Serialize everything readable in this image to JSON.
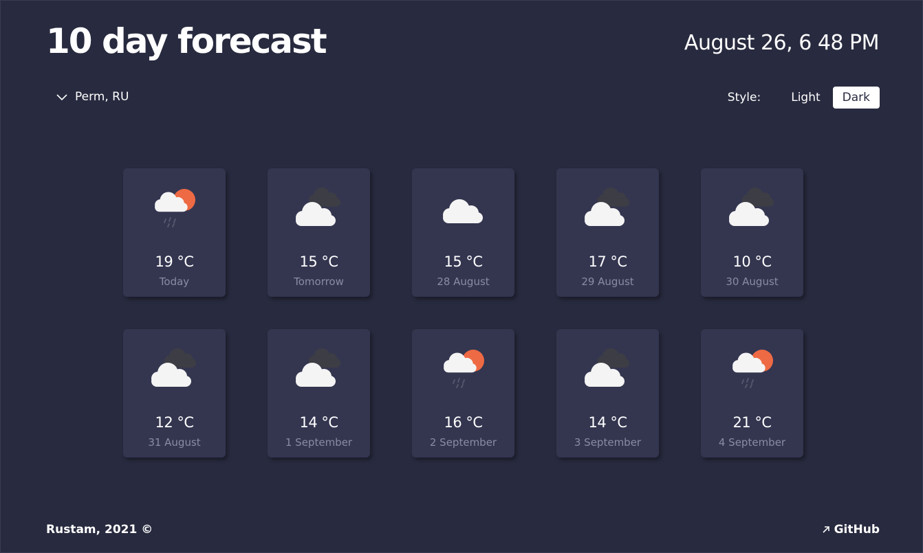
{
  "header": {
    "title": "10 day forecast",
    "datetime": "August 26, 6 48 PM"
  },
  "location": {
    "label": "Perm, RU",
    "icon": "chevron-down-icon"
  },
  "style_switch": {
    "label": "Style:",
    "options": [
      "Light",
      "Dark"
    ],
    "selected": "Dark"
  },
  "forecast": [
    {
      "temp": "19 °C",
      "day": "Today",
      "icon": "sun-cloud-rain-icon"
    },
    {
      "temp": "15 °C",
      "day": "Tomorrow",
      "icon": "dark-cloud-icon"
    },
    {
      "temp": "15 °C",
      "day": "28 August",
      "icon": "cloud-icon"
    },
    {
      "temp": "17 °C",
      "day": "29 August",
      "icon": "dark-cloud-icon"
    },
    {
      "temp": "10 °C",
      "day": "30 August",
      "icon": "dark-cloud-icon"
    },
    {
      "temp": "12 °C",
      "day": "31 August",
      "icon": "dark-cloud-icon"
    },
    {
      "temp": "14 °C",
      "day": "1 September",
      "icon": "dark-cloud-icon"
    },
    {
      "temp": "16 °C",
      "day": "2 September",
      "icon": "sun-cloud-rain-icon"
    },
    {
      "temp": "14 °C",
      "day": "3 September",
      "icon": "dark-cloud-icon"
    },
    {
      "temp": "21 °C",
      "day": "4 September",
      "icon": "sun-cloud-rain-icon"
    }
  ],
  "footer": {
    "credit": "Rustam, 2021 ©",
    "link_label": "GitHub",
    "link_icon": "arrow-up-right-icon"
  },
  "colors": {
    "background": "#282a3f",
    "card": "#343650",
    "text": "#ffffff",
    "muted_text": "#8a8ca3",
    "sun": "#ee6a44",
    "cloud": "#f4f4f4",
    "dark_cloud": "#3d3d45"
  }
}
